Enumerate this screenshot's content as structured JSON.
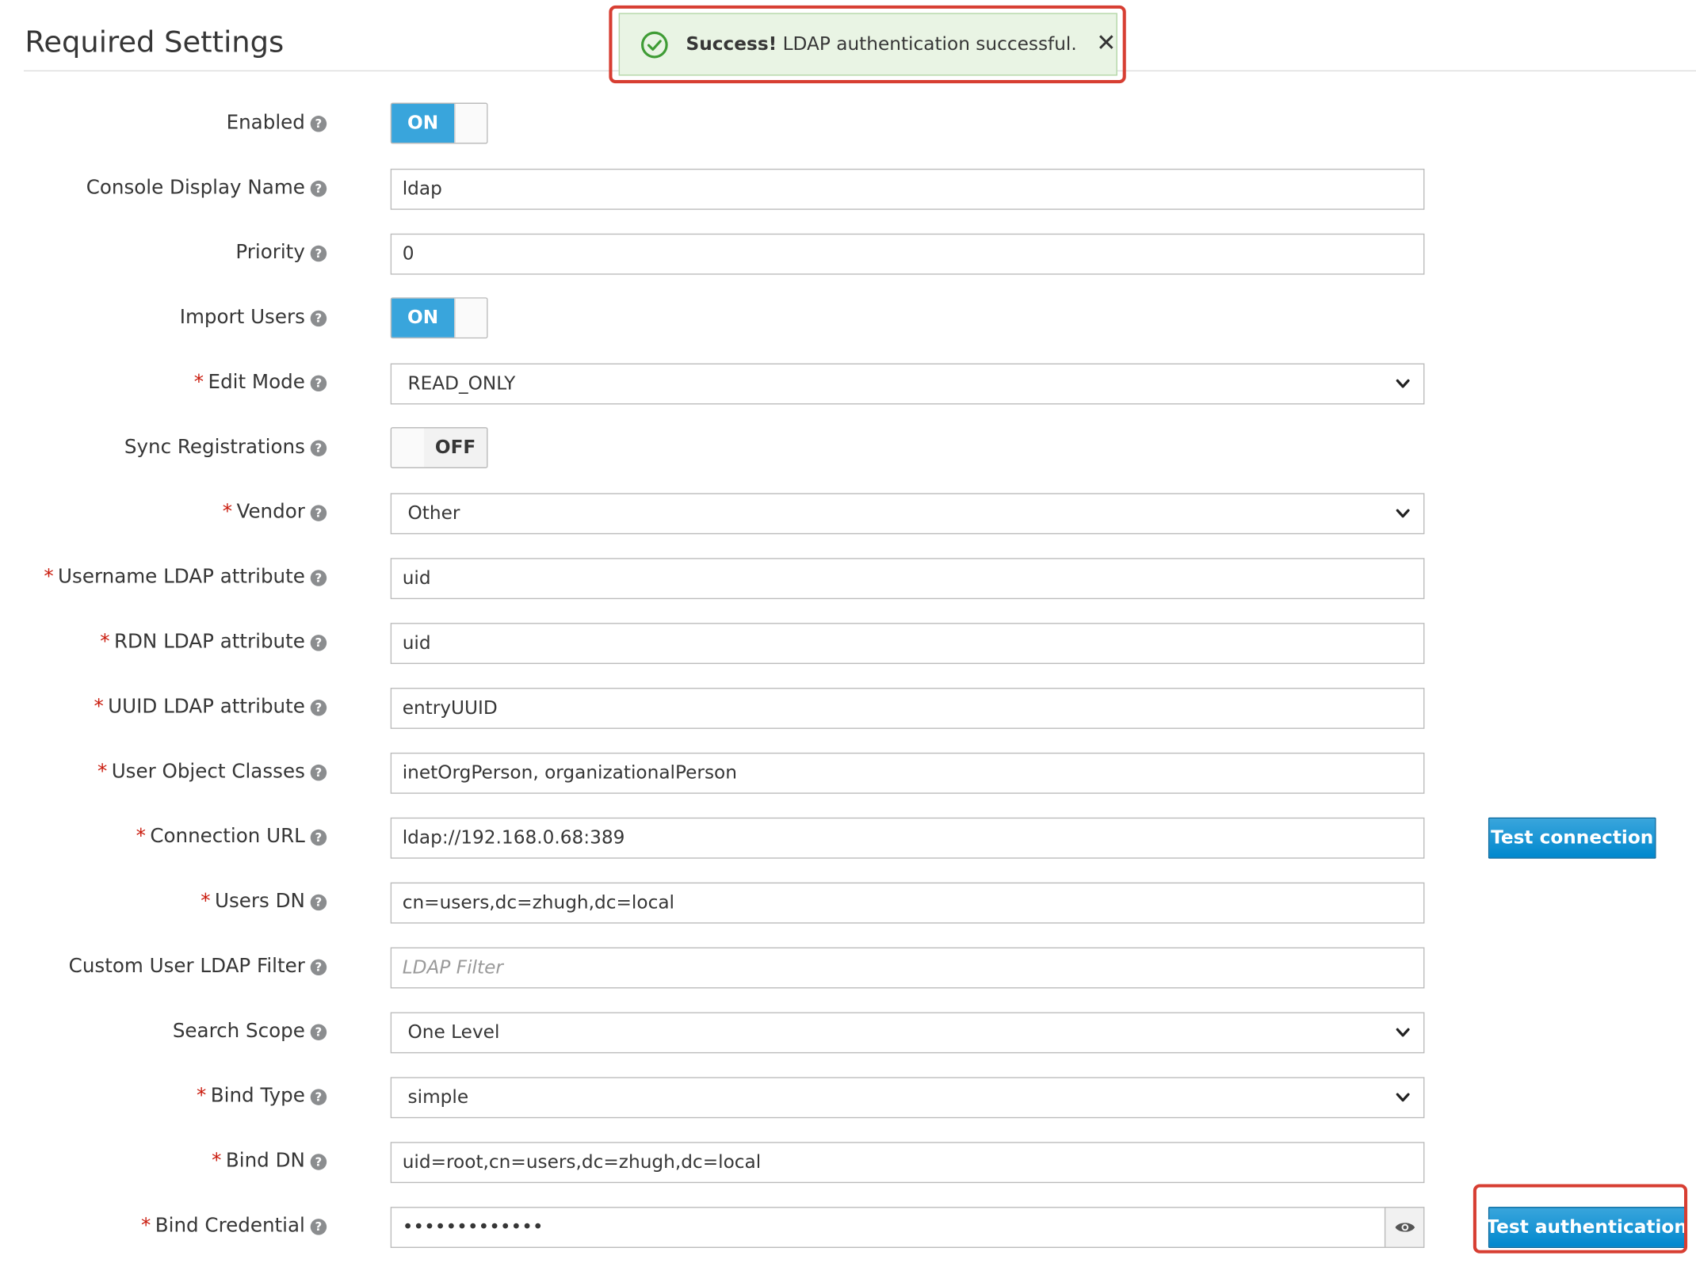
{
  "section": {
    "title": "Required Settings"
  },
  "alert": {
    "strong": "Success!",
    "message": " LDAP authentication successful.",
    "close": "✕",
    "accent": "#3f9c35"
  },
  "help_glyph": "?",
  "required_mark": "*",
  "fields": {
    "enabled": {
      "label": "Enabled",
      "state": "ON"
    },
    "console_display_name": {
      "label": "Console Display Name",
      "value": "ldap"
    },
    "priority": {
      "label": "Priority",
      "value": "0"
    },
    "import_users": {
      "label": "Import Users",
      "state": "ON"
    },
    "edit_mode": {
      "label": "Edit Mode",
      "value": "READ_ONLY"
    },
    "sync_registrations": {
      "label": "Sync Registrations",
      "state": "OFF"
    },
    "vendor": {
      "label": "Vendor",
      "value": "Other"
    },
    "username_ldap_attribute": {
      "label": "Username LDAP attribute",
      "value": "uid"
    },
    "rdn_ldap_attribute": {
      "label": "RDN LDAP attribute",
      "value": "uid"
    },
    "uuid_ldap_attribute": {
      "label": "UUID LDAP attribute",
      "value": "entryUUID"
    },
    "user_object_classes": {
      "label": "User Object Classes",
      "value": "inetOrgPerson, organizationalPerson"
    },
    "connection_url": {
      "label": "Connection URL",
      "value": "ldap://192.168.0.68:389"
    },
    "users_dn": {
      "label": "Users DN",
      "value": "cn=users,dc=zhugh,dc=local"
    },
    "custom_user_ldap_filter": {
      "label": "Custom User LDAP Filter",
      "value": "",
      "placeholder": "LDAP Filter"
    },
    "search_scope": {
      "label": "Search Scope",
      "value": "One Level"
    },
    "bind_type": {
      "label": "Bind Type",
      "value": "simple"
    },
    "bind_dn": {
      "label": "Bind DN",
      "value": "uid=root,cn=users,dc=zhugh,dc=local"
    },
    "bind_credential": {
      "label": "Bind Credential",
      "value": "•••••••••••••"
    }
  },
  "buttons": {
    "test_connection": "Test connection",
    "test_authentication": "Test authentication"
  },
  "colors": {
    "primary": "#0088ce",
    "toggle_on": "#39a5dc",
    "required": "#c9190b",
    "highlight": "#d73e32"
  }
}
